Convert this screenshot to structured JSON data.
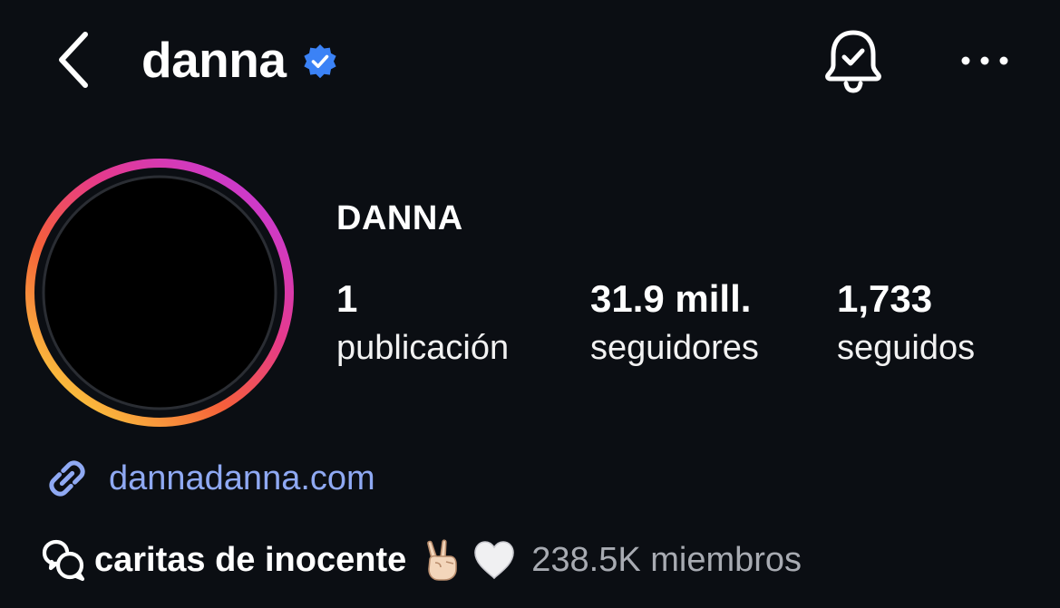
{
  "header": {
    "username": "danna",
    "verified": true,
    "accent_verified": "#3b82f6"
  },
  "profile": {
    "display_name": "DANNA",
    "stats": [
      {
        "value": "1",
        "label": "publicación"
      },
      {
        "value": "31.9 mill.",
        "label": "seguidores"
      },
      {
        "value": "1,733",
        "label": "seguidos"
      }
    ]
  },
  "link": {
    "text": "dannadanna.com",
    "color": "#8fa9f3"
  },
  "channel": {
    "name": "caritas de inocente",
    "emojis": [
      "victory-hand",
      "white-heart"
    ],
    "members": "238.5K miembros"
  },
  "icons": [
    "back-chevron-icon",
    "verified-badge-icon",
    "bell-check-icon",
    "more-dots-icon",
    "link-icon",
    "broadcast-channel-icon"
  ],
  "colors": {
    "background": "#0b0e13",
    "story_ring": [
      "#fbc83d",
      "#f5603a",
      "#e63a8a",
      "#c93ad4"
    ]
  }
}
